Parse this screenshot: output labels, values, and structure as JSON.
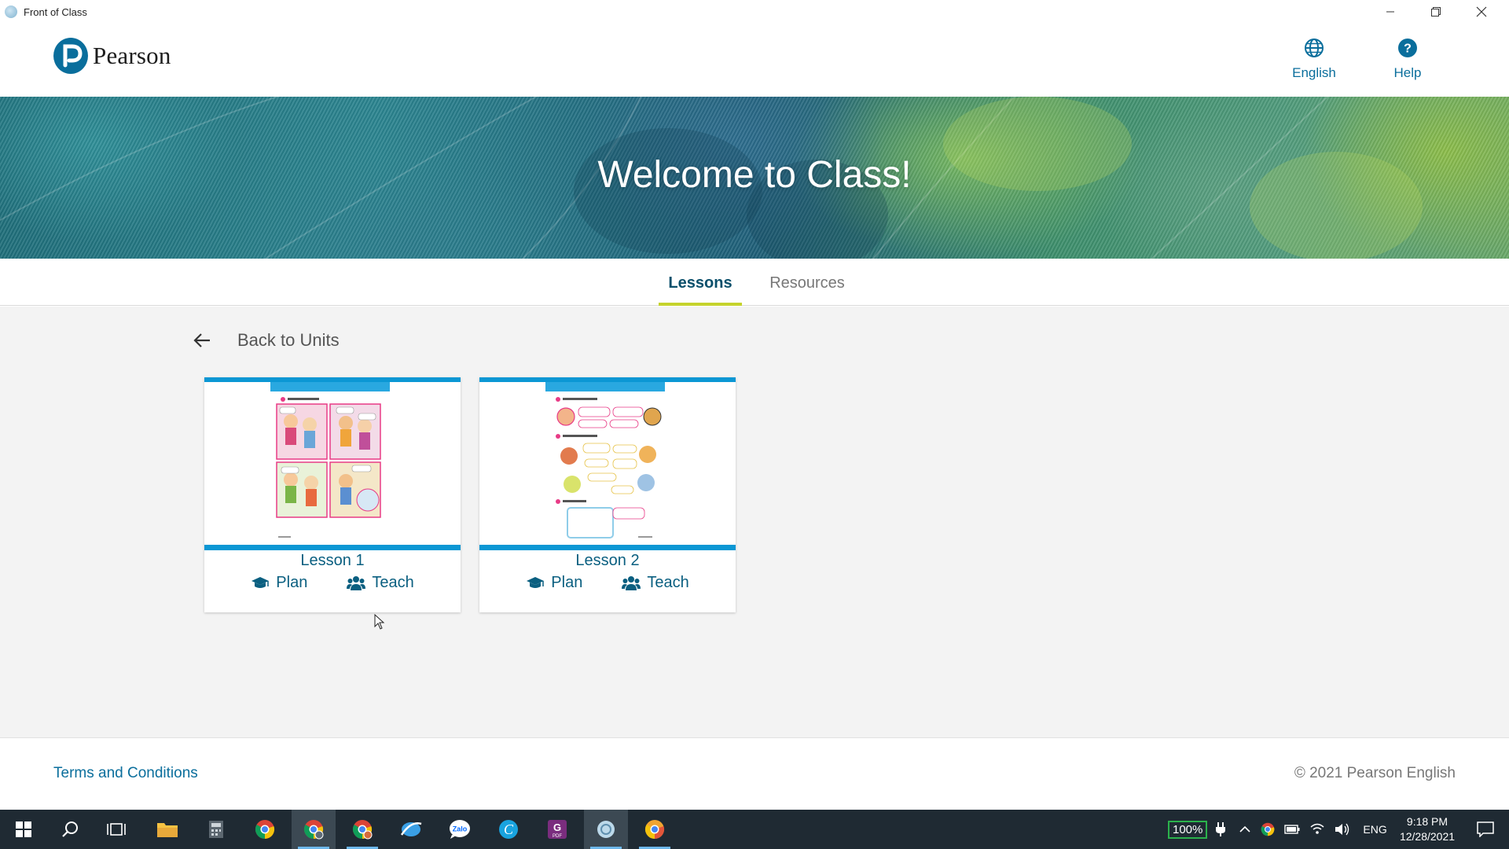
{
  "window": {
    "title": "Front of Class"
  },
  "header": {
    "brand": "Pearson",
    "language_label": "English",
    "help_label": "Help"
  },
  "hero": {
    "title": "Welcome to Class!"
  },
  "tabs": [
    {
      "label": "Lessons",
      "active": true
    },
    {
      "label": "Resources",
      "active": false
    }
  ],
  "navigation": {
    "back_label": "Back to Units"
  },
  "lessons": [
    {
      "title": "Lesson 1",
      "plan_label": "Plan",
      "teach_label": "Teach"
    },
    {
      "title": "Lesson 2",
      "plan_label": "Plan",
      "teach_label": "Teach"
    }
  ],
  "footer": {
    "terms_label": "Terms and Conditions",
    "copyright": "© 2021 Pearson English"
  },
  "taskbar": {
    "battery": "100%",
    "language": "ENG",
    "time": "9:18 PM",
    "date": "12/28/2021"
  },
  "colors": {
    "brand": "#0a6e9c",
    "tab_indicator": "#c5d32c",
    "card_accent": "#0b97d4",
    "taskbar": "#1f2a33"
  }
}
